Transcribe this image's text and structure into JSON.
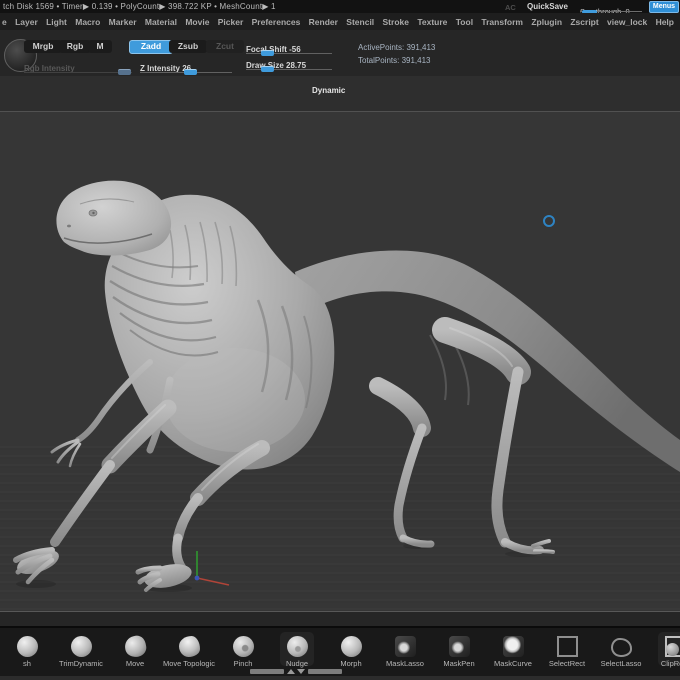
{
  "window": {
    "title_left": "tch Disk 1569  •  Timer▶ 0.139  •  PolyCount▶ 398.722 KP   •  MeshCount▶ 1",
    "ac": "AC",
    "quicksave": "QuickSave",
    "see_through_label": "See-through",
    "see_through_value": "0",
    "menus_button": "Menus"
  },
  "menubar": {
    "items": [
      "e",
      "Layer",
      "Light",
      "Macro",
      "Marker",
      "Material",
      "Movie",
      "Picker",
      "Preferences",
      "Render",
      "Stencil",
      "Stroke",
      "Texture",
      "Tool",
      "Transform",
      "Zplugin",
      "Zscript",
      "view_lock",
      "Help"
    ]
  },
  "toolbar": {
    "mrgb": "Mrgb",
    "rgb": "Rgb",
    "m": "M",
    "zadd": "Zadd",
    "zsub": "Zsub",
    "zcut": "Zcut",
    "rgb_intensity_label": "Rgb Intensity",
    "z_intensity_label": "Z Intensity 26",
    "focal_shift_label": "Focal Shift -56",
    "draw_size_label": "Draw Size 28.75",
    "dynamic_label": "Dynamic",
    "active_points": "ActivePoints: 391,413",
    "total_points": "TotalPoints: 391,413"
  },
  "tray": {
    "items": [
      {
        "label": "sh",
        "icon": "icon-sphere"
      },
      {
        "label": "TrimDynamic",
        "icon": "icon-sphere"
      },
      {
        "label": "Move",
        "icon": "icon-move"
      },
      {
        "label": "Move Topologic",
        "icon": "icon-topo"
      },
      {
        "label": "Pinch",
        "icon": "icon-pinch"
      },
      {
        "label": "Nudge",
        "icon": "icon-nudge",
        "state": "hl"
      },
      {
        "label": "Morph",
        "icon": "icon-sphere"
      },
      {
        "label": "MaskLasso",
        "icon": "icon-masklasso"
      },
      {
        "label": "MaskPen",
        "icon": "icon-maskpen"
      },
      {
        "label": "MaskCurve",
        "icon": "icon-maskcurve"
      },
      {
        "label": "SelectRect",
        "icon": "icon-selectrect"
      },
      {
        "label": "SelectLasso",
        "icon": "icon-selectlasso"
      },
      {
        "label": "ClipRect",
        "icon": "icon-cliprect",
        "state": "hl"
      }
    ]
  },
  "colors": {
    "accent_blue": "#3f9bdc",
    "canvas_gray": "#363636",
    "model_gray": "#b5b5b5"
  }
}
